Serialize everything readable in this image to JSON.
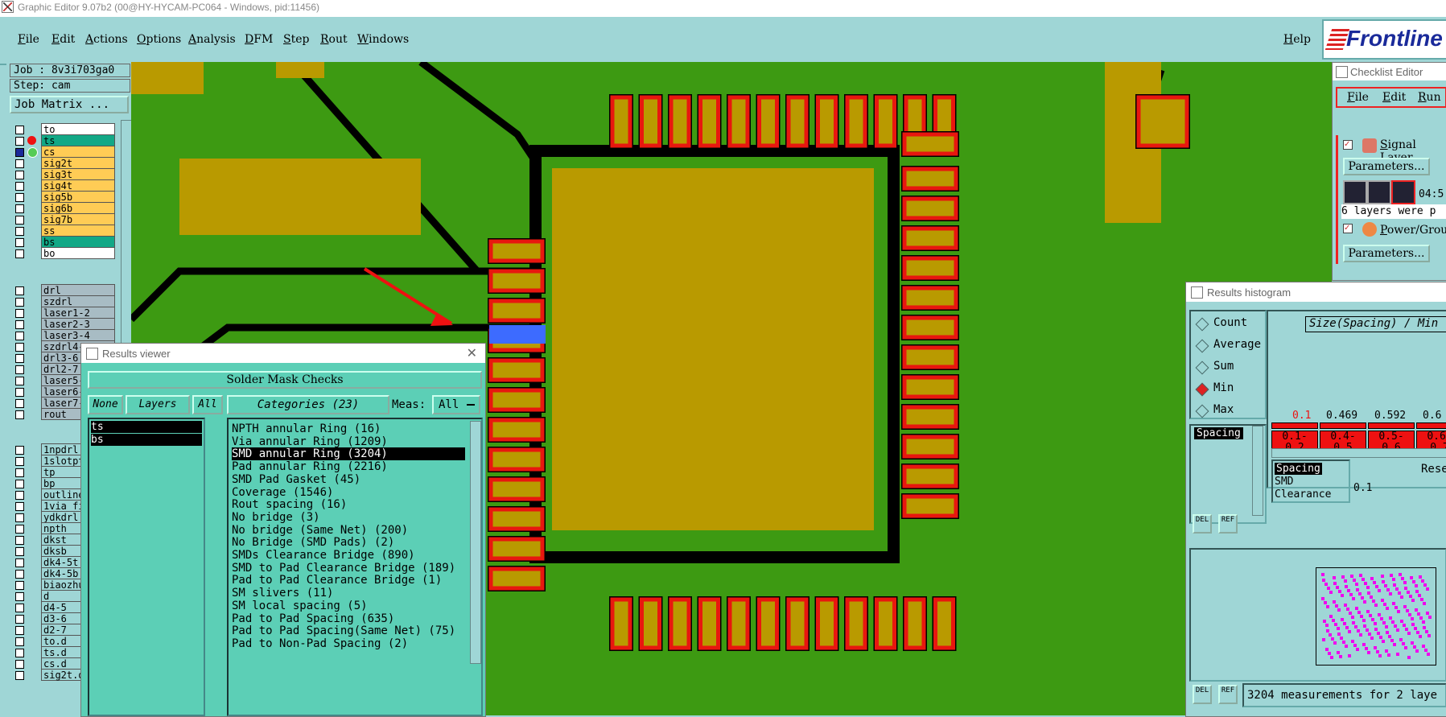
{
  "app_title": "Graphic Editor 9.07b2 (00@HY-HYCAM-PC064 - Windows, pid:11456)",
  "menu": {
    "file": "File",
    "edit": "Edit",
    "actions": "Actions",
    "options": "Options",
    "analysis": "Analysis",
    "dfm": "DFM",
    "step": "Step",
    "rout": "Rout",
    "windows": "Windows",
    "help": "Help"
  },
  "brand": "Frontline",
  "job": {
    "job_label": "Job : 8v3i703ga0",
    "step_label": "Step: cam",
    "matrix_button": "Job Matrix ..."
  },
  "layers_group1": [
    "to",
    "ts",
    "cs",
    "sig2t",
    "sig3t",
    "sig4t",
    "sig5b",
    "sig6b",
    "sig7b",
    "ss",
    "bs",
    "bo"
  ],
  "layers_group2": [
    "drl",
    "szdrl",
    "laser1-2",
    "laser2-3",
    "laser3-4",
    "szdrl4-5",
    "drl3-6",
    "drl2-7",
    "laser5-6",
    "laser6-7",
    "laser7-8",
    "rout"
  ],
  "layers_group3": [
    "1npdrl",
    "1slotpth",
    "tp",
    "bp",
    "outline",
    "1via_fil",
    "ydkdrl",
    "npth",
    "dkst",
    "dksb",
    "dk4-5t",
    "dk4-5b",
    "biaozhu",
    "d",
    "d4-5",
    "d3-6",
    "d2-7",
    "to.d",
    "ts.d",
    "cs.d",
    "sig2t.d"
  ],
  "colors": {
    "background": "#9fd6d6",
    "board": "#3d9a12",
    "copper": "#b99a00",
    "pad_outline": "#e8170f",
    "silk": "#000000",
    "highlight": "#3d6bff",
    "ts_layer": "#12a886",
    "signal_layer": "#ffcc55",
    "drill_layer": "#a8bcc4"
  },
  "results_viewer": {
    "title": "Results viewer",
    "header": "Solder Mask Checks",
    "none_btn": "None",
    "layers_btn": "Layers",
    "all_btn": "All",
    "categories_btn": "Categories (23)",
    "meas_label": "Meas:",
    "meas_value": "All",
    "layer_items": [
      "ts",
      "bs"
    ],
    "categories": [
      "NPTH annular Ring (16)",
      "Via annular Ring (1209)",
      "SMD annular Ring (3204)",
      "Pad annular Ring (2216)",
      "SMD Pad Gasket (45)",
      "Coverage (1546)",
      "Rout spacing (16)",
      "No bridge (3)",
      "No bridge (Same Net) (200)",
      "No Bridge (SMD Pads) (2)",
      "SMDs Clearance Bridge (890)",
      "SMD to Pad Clearance Bridge (189)",
      "Pad to Pad Clearance Bridge (1)",
      "SM slivers (11)",
      "SM local spacing (5)",
      "Pad to Pad Spacing (635)",
      "Pad to Pad Spacing(Same Net) (75)",
      "Pad to Non-Pad Spacing (2)"
    ],
    "selected_index": 2
  },
  "checklist_editor": {
    "title": "Checklist Editor",
    "menu": {
      "file": "File",
      "edit": "Edit",
      "run": "Run"
    },
    "signal_layers": "Signal Layer",
    "parameters1": "Parameters...",
    "time": "04:5",
    "message": "6 layers were p",
    "power_ground": "Power/Groun",
    "parameters2": "Parameters..."
  },
  "histogram": {
    "title": "Results histogram",
    "options": [
      "Count",
      "Average",
      "Sum",
      "Min",
      "Max"
    ],
    "selected_option": "Min",
    "chart_title": "Size(Spacing) / Min",
    "list_selected": "Spacing",
    "bar_values": [
      "0.1",
      "0.469",
      "0.592",
      "0.6"
    ],
    "bins": [
      [
        "0.1-",
        "0.2"
      ],
      [
        "0.4-",
        "0.5"
      ],
      [
        "0.5-",
        "0.6"
      ],
      [
        "0.6-",
        "0.7"
      ]
    ],
    "del_label": "DEL",
    "ref_label": "REF",
    "sub_list": [
      "Spacing",
      "SMD",
      "Clearance"
    ],
    "res_label": "Rese",
    "res_value": "0.1",
    "status": "3204 measurements for 2 laye"
  }
}
